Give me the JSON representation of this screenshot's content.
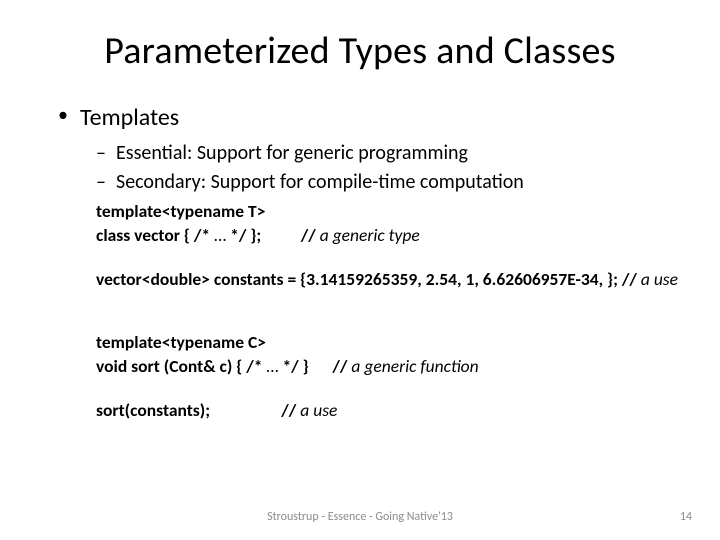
{
  "title": "Parameterized Types and Classes",
  "bullets": {
    "templates": "Templates",
    "essential": "Essential: Support for generic programming",
    "secondary": "Secondary: Support for compile-time computation"
  },
  "code": {
    "templateT": "template<typename T>",
    "classVector_pre": "class vector { /* ",
    "classVector_ellipsis": "…",
    "classVector_mid": " */ };          // ",
    "classVector_comment": "a generic type",
    "constants_pre": "vector<double> constants = {3.14159265359, 2.54, 1, 6.62606957E-34, }; // ",
    "constants_comment": "a use",
    "templateC": "template<typename C>",
    "sortDecl_pre": "void sort (Cont& c) { /* ",
    "sortDecl_ellipsis": "…",
    "sortDecl_mid": " */ }      // ",
    "sortDecl_comment": "a generic function",
    "sortCall_pre": "sort(constants);                  // ",
    "sortCall_comment": "a use"
  },
  "footer": {
    "center": "Stroustrup - Essence - Going Native'13",
    "page": "14"
  }
}
